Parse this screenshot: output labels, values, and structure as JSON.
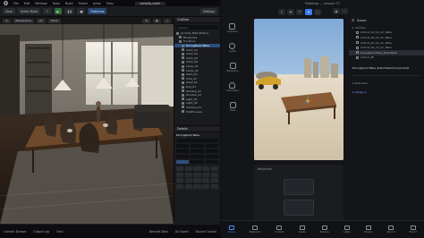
{
  "ue": {
    "menu": [
      "File",
      "Edit",
      "Window",
      "Tools",
      "Build",
      "Select",
      "Actor",
      "Help"
    ],
    "doc_tab": "archvis_main",
    "toolbar": [
      "Save",
      "Select Mode",
      "Platforms",
      "Settings"
    ],
    "viewport_buttons": [
      "Perspective",
      "Lit",
      "Show"
    ],
    "outliner_title": "Outliner",
    "outliner_search": "Search...",
    "outliner_items": [
      "ArchVis_MAP (Editor)",
      "Blueprints",
      "Furniture",
      "DiningRoomTable",
      "Chair_01",
      "Chair_02",
      "Chair_03",
      "Chair_04",
      "Lamp_01",
      "Lamp_02",
      "Plant_01",
      "Sofa_01",
      "Shelf_01",
      "Rug_01",
      "Window_01",
      "Window_02",
      "Light_01",
      "Light_02",
      "Camera_01",
      "PostProcess"
    ],
    "outliner_selected_index": 3,
    "details_title": "Details",
    "details_selected": "DiningRoomTable",
    "status": [
      "Content Drawer",
      "Output Log",
      "Cmd",
      "Derived Data",
      "All Saved",
      "Source Control"
    ]
  },
  "rc": {
    "title": "Tabletop — Lesson 07",
    "tools": [
      "↖",
      "✥",
      "⤧",
      "+",
      "▢"
    ],
    "tools_on_index": 3,
    "left_items": [
      "Inspector",
      "Lights",
      "Behaviors",
      "Characters",
      "Tools"
    ],
    "scene_title": "Scene",
    "scene_root": "Anchors",
    "scene_items": [
      "Archviz_Sm_01_dir_Table",
      "Archviz_Sm_01_dir_Table",
      "Archviz_Sm_01_dir_Table",
      "Archviz_Sm_01_dir_Table",
      "DiningRoomTable_StaticMesh",
      "Archviz_PP"
    ],
    "scene_selected_index": 4,
    "component_label": "DiningRoomTable_StaticMeshComponent0",
    "section_metadata": "Metadata",
    "section_category": "Category",
    "behaviors_title": "Behaviors",
    "bottom_tabs": [
      "Scene",
      "Behaviors",
      "Content",
      "Assets",
      "Preview",
      "Lights",
      "Physics",
      "Record",
      "Export"
    ],
    "bottom_on_index": 0
  }
}
